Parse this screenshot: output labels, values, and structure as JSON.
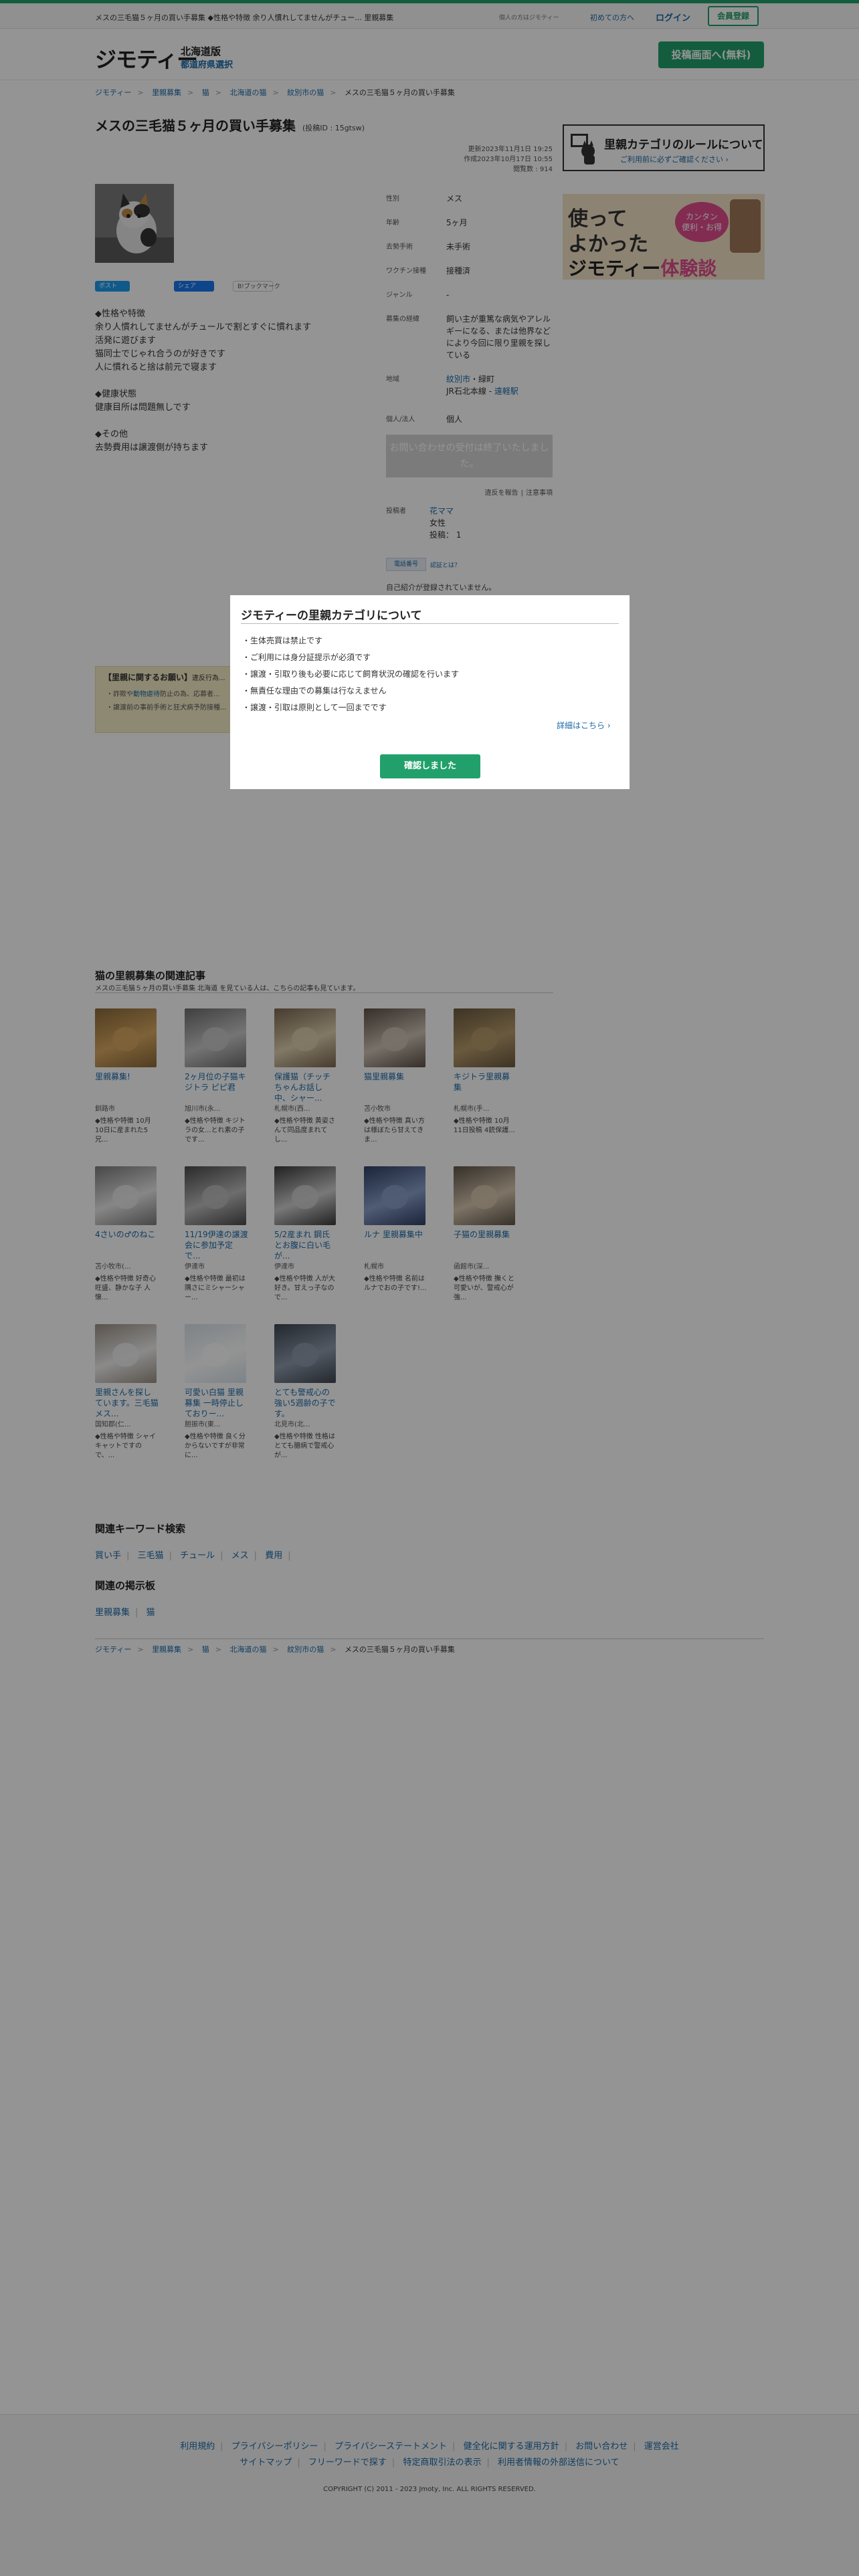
{
  "topbar": {
    "page_text": "メスの三毛猫５ヶ月の買い手募集 ◆性格や特徴 余り人慣れしてませんがチュー... 里親募集",
    "biz_text": "個人の方はジモティー",
    "first_time": "初めての方へ",
    "login": "ログイン",
    "register": "会員登録"
  },
  "header": {
    "logo": "ジモティー",
    "region": "北海道版",
    "region_select": "都道府県選択",
    "post_button": "投稿画面へ(無料)"
  },
  "breadcrumb": [
    "ジモティー",
    "里親募集",
    "猫",
    "北海道の猫",
    "紋別市の猫",
    "メスの三毛猫５ヶ月の買い手募集"
  ],
  "listing": {
    "title": "メスの三毛猫５ヶ月の買い手募集",
    "post_id": "(投稿ID : 15gtsw)",
    "updated": "更新2023年11月1日 19:25",
    "created": "作成2023年10月17日 10:55",
    "views": "閲覧数 : 914",
    "share": {
      "twitter": "ポスト",
      "facebook": "シェア",
      "hatena": "B!ブックマーク"
    },
    "description": [
      "◆性格や特徴",
      "余り人慣れしてませんがチュールで割とすぐに慣れます",
      "活発に遊びます",
      "猫同士でじゃれ合うのが好きです",
      "人に慣れると捨は前元で寝ます",
      "",
      "◆健康状態",
      "健康目所は問題無しです",
      "",
      "◆その他",
      "去勢費用は譲渡側が持ちます"
    ]
  },
  "info": {
    "rows": [
      {
        "key": "性別",
        "value": "メス"
      },
      {
        "key": "年齢",
        "value": "5ヶ月"
      },
      {
        "key": "去勢手術",
        "value": "未手術"
      },
      {
        "key": "ワクチン接種",
        "value": "接種済"
      },
      {
        "key": "ジャンル",
        "value": "-"
      },
      {
        "key": "募集の経緯",
        "value": "飼い主が重篤な病気やアレルギーになる、または他界などにより今回に限り里親を探している"
      },
      {
        "key": "地域",
        "value": "紋別市・緑町"
      },
      {
        "key": "個人/法人",
        "value": "個人"
      }
    ],
    "station_line": "JR石北本線 - 遠軽駅",
    "station_prefix": "JR石北本線 - ",
    "station_link": "遠軽駅",
    "region_link": "紋別市",
    "region_rest": "・緑町",
    "inquiry_button": "お問い合わせの受付は終了いたしました。",
    "report": "違反を報告",
    "caution": "注意事項",
    "poster_label": "投稿者",
    "poster_name": "花ママ",
    "poster_gender": "女性",
    "poster_posts": "投稿： 1",
    "verify_badge": "電話番号",
    "verify_what": "認証とは？",
    "not_verified": "自己紹介が登録されていません。"
  },
  "banners": {
    "rule_title": "里親カテゴリのルールについて",
    "rule_sub": "ご利用前に必ずご確認ください ›",
    "exp_line1": "使って",
    "exp_line2": "よかった",
    "exp_line3a": "ジモティー",
    "exp_line3b": "体験談",
    "exp_bubble": "カンタン\n便利・お得"
  },
  "request": {
    "heading": "【里親に関するお願い】",
    "heading_sub": "違反行為...",
    "line1_a": "・詐欺や",
    "line1_link": "動物虐待",
    "line1_b": "防止の為、応募者...",
    "line2": "・譲渡前の事前手術と狂犬病予防接種..."
  },
  "modal": {
    "title": "ジモティーの里親カテゴリについて",
    "rules": [
      "・生体売買は禁止です",
      "・ご利用には身分証提示が必須です",
      "・譲渡・引取り後も必要に応じて飼育状況の確認を行います",
      "・無責任な理由での募集は行なえません",
      "・譲渡・引取は原則として一回までです"
    ],
    "more": "詳細はこちら ›",
    "confirm": "確認しました"
  },
  "related": {
    "heading": "猫の里親募集の関連記事",
    "subheading": "メスの三毛猫５ヶ月の買い手募集 北海道 を見ている人は、こちらの記事も見ています。",
    "cards": [
      {
        "title": "里親募集!",
        "loc": "釧路市",
        "excerpt": "◆性格や特徴 10月10日に産まれた5兄..."
      },
      {
        "title": "2ヶ月位の子猫キジトラ ピピ君",
        "loc": "旭川市(永...",
        "excerpt": "◆性格や特徴 キジトラの女...とれ素の子です..."
      },
      {
        "title": "保護猫（チッチちゃんお話し中、シャー...",
        "loc": "札幌市(西...",
        "excerpt": "◆性格や特徴 黄姿さんて同品度まれてし..."
      },
      {
        "title": "猫里親募集",
        "loc": "苫小牧市",
        "excerpt": "◆性格や特徴 真い方は様ぼたら甘えてきま..."
      },
      {
        "title": "キジトラ里親募集",
        "loc": "札幌市(手...",
        "excerpt": "◆性格や特徴 10月11日投稿 4銃保護..."
      },
      {
        "title": "4さいの♂のねこ",
        "loc": "苫小牧市(...",
        "excerpt": "◆性格や特徴 好奇心旺盛、静かな子 人懐..."
      },
      {
        "title": "11/19伊達の譲渡会に参加予定で...",
        "loc": "伊達市",
        "excerpt": "◆性格や特徴 最初は隅さにミシャーシャー..."
      },
      {
        "title": "5/2産まれ 鋼氏とお腹に白い毛が...",
        "loc": "伊達市",
        "excerpt": "◆性格や特徴 人が大好き。甘えっ子なので..."
      },
      {
        "title": "ルナ 里親募集中",
        "loc": "札幌市",
        "excerpt": "◆性格や特徴 名前はルナでおの子です!..."
      },
      {
        "title": "子猫の里親募集",
        "loc": "函館市(深...",
        "excerpt": "◆性格や特徴 撫くと可愛いが、警戒心が強..."
      },
      {
        "title": "里親さんを探しています。三毛猫メス...",
        "loc": "国知郡(仁...",
        "excerpt": "◆性格や特徴 シャイキャットですので、..."
      },
      {
        "title": "可愛い白猫 里親募集 一時停止しておりー...",
        "loc": "胆振市(東...",
        "excerpt": "◆性格や特徴 良く分からないですが非常に..."
      },
      {
        "title": "とても警戒心の強い5週齢の子です。",
        "loc": "北見市(北...",
        "excerpt": "◆性格や特徴 性格はとても臆病で警戒心が..."
      }
    ]
  },
  "keywords": {
    "heading": "関連キーワード検索",
    "items": [
      "買い手",
      "三毛猫",
      "チュール",
      "メス",
      "費用"
    ]
  },
  "boards": {
    "heading": "関連の掲示板",
    "items": [
      "里親募集",
      "猫"
    ]
  },
  "footer": {
    "row1": [
      "利用規約",
      "プライバシーポリシー",
      "プライバシーステートメント",
      "健全化に関する運用方針",
      "お問い合わせ",
      "運営会社"
    ],
    "row2": [
      "サイトマップ",
      "フリーワードで探す",
      "特定商取引法の表示",
      "利用者情報の外部送信について"
    ],
    "copyright": "COPYRIGHT (C) 2011 - 2023 Jmoty, Inc. ALL RIGHTS RESERVED."
  },
  "colors": {
    "brand": "#22a06b",
    "link": "#1a6aa8",
    "overlay": "rgba(0,0,0,0.42)"
  }
}
